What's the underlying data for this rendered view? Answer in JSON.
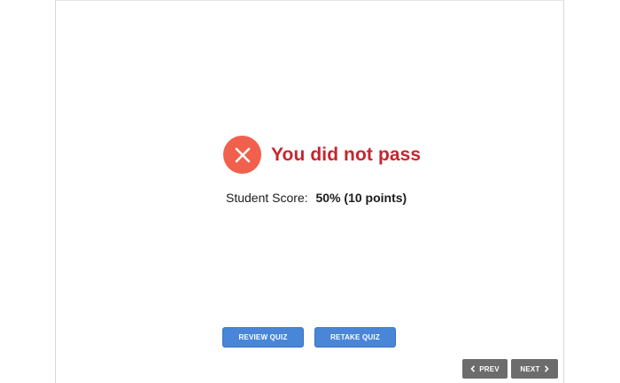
{
  "result": {
    "status_icon": "close-icon",
    "title": "You did not pass",
    "colors": {
      "icon_bg": "#f0604c",
      "title": "#c4262e"
    }
  },
  "score": {
    "label": "Student Score:",
    "value": "50% (10 points)"
  },
  "actions": {
    "review_label": "REVIEW QUIZ",
    "retake_label": "RETAKE QUIZ",
    "button_color": "#4a86d8"
  },
  "navigation": {
    "prev_label": "PREV",
    "next_label": "NEXT",
    "prev_icon": "chevron-left-icon",
    "next_icon": "chevron-right-icon",
    "button_color": "#6c6c6c"
  }
}
